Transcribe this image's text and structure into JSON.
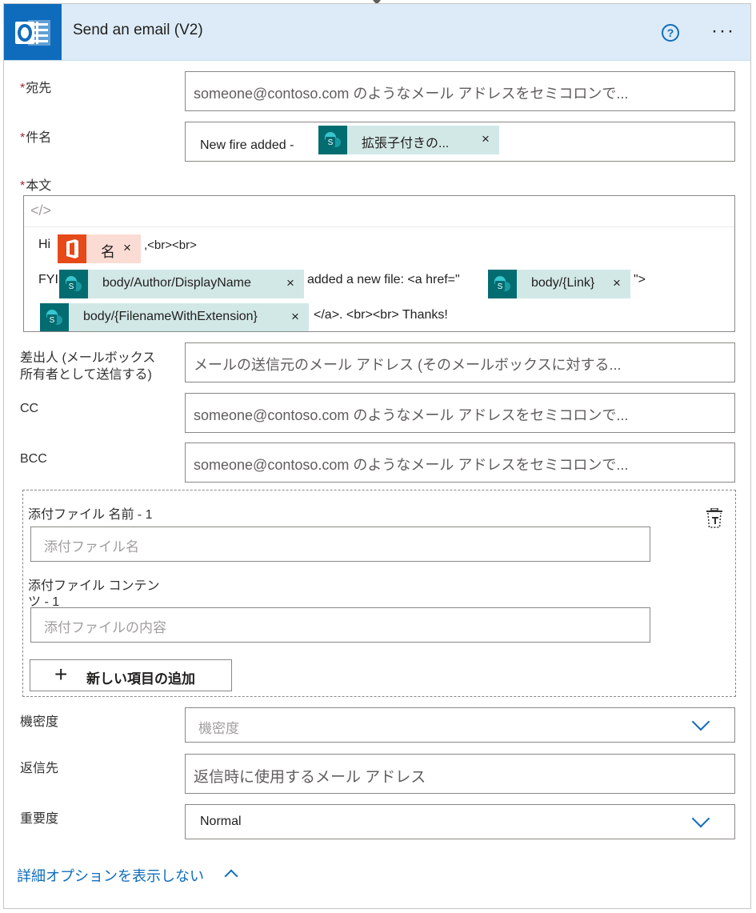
{
  "header": {
    "title": "Send an email (V2)",
    "help_label": "?",
    "more_label": "···"
  },
  "fields": {
    "to": {
      "label": "宛先",
      "placeholder": "someone@contoso.com のようなメール アドレスをセミコロンで..."
    },
    "subject": {
      "label": "件名",
      "prefix": "New fire added -",
      "token": "拡張子付きの..."
    },
    "body": {
      "label": "本文",
      "code_icon": "</>",
      "line1": {
        "prefix": "Hi",
        "token": "名",
        "suffix": ",<br><br>"
      },
      "line2": {
        "prefix": "FYI",
        "token1": "body/Author/DisplayName",
        "middle": "added a new file: <a href=\"",
        "token2": "body/{Link}",
        "suffix": "\">"
      },
      "line3": {
        "token": "body/{FilenameWithExtension}",
        "suffix": "</a>. <br><br> Thanks!"
      }
    },
    "from": {
      "label_line1": "差出人 (メールボックス",
      "label_line2": "所有者として送信する)",
      "placeholder": "メールの送信元のメール アドレス (そのメールボックスに対する..."
    },
    "cc": {
      "label": "CC",
      "placeholder": "someone@contoso.com のようなメール アドレスをセミコロンで..."
    },
    "bcc": {
      "label": "BCC",
      "placeholder": "someone@contoso.com のようなメール アドレスをセミコロンで..."
    },
    "attachments": {
      "name_label": "添付ファイル 名前 - 1",
      "name_placeholder": "添付ファイル名",
      "content_label_line1": "添付ファイル コンテン",
      "content_label_line2": "ツ - 1",
      "content_placeholder": "添付ファイルの内容",
      "add_button": "新しい項目の追加",
      "add_icon": "+"
    },
    "sensitivity": {
      "label": "機密度",
      "placeholder": "機密度"
    },
    "reply_to": {
      "label": "返信先",
      "placeholder": "返信時に使用するメール アドレス"
    },
    "importance": {
      "label": "重要度",
      "value": "Normal"
    }
  },
  "footer": {
    "link": "詳細オプションを表示しない"
  },
  "token_close": "×",
  "required_mark": "*",
  "colors": {
    "accent": "#0f6cbd",
    "header_bg": "#dcebf7",
    "sharepoint_token_bg": "#d2e8e6",
    "sharepoint_icon": "#036c70",
    "office_token_bg": "#fbdcd4",
    "office_icon": "#e64a19",
    "required": "#a4262c"
  }
}
